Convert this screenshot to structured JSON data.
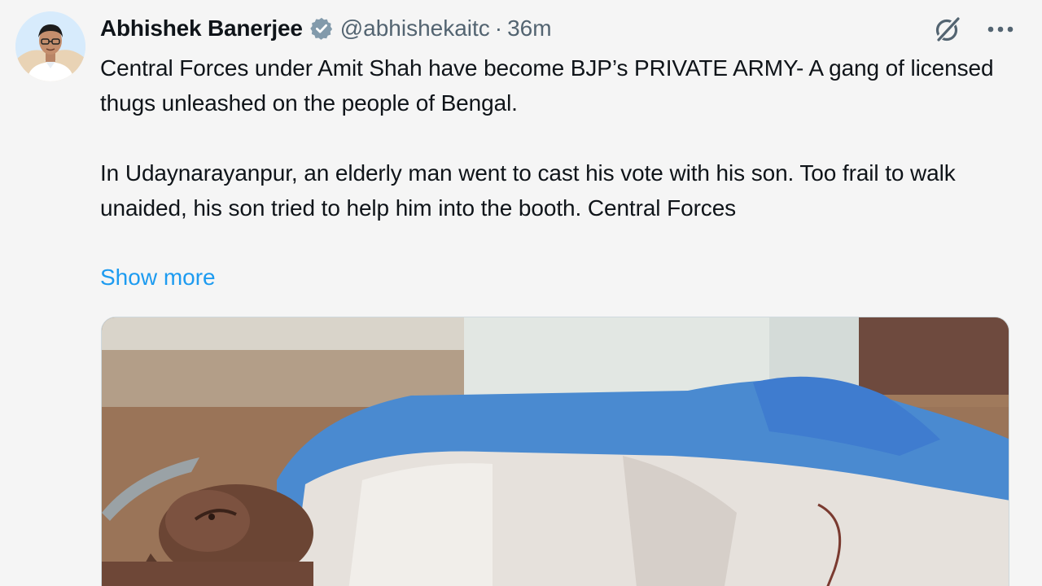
{
  "tweet": {
    "author_name": "Abhishek Banerjee",
    "handle": "@abhishekaitc",
    "separator": "·",
    "time": "36m",
    "paragraphs": [
      "Central Forces under Amit Shah have become BJP’s PRIVATE ARMY- A gang of licensed thugs unleashed on the people of Bengal.",
      "In Udaynarayanpur, an elderly man went to cast his vote with his son. Too frail to walk unaided, his son tried to help him into the booth. Central Forces"
    ],
    "show_more": "Show more"
  },
  "icons": {
    "verified": "verified-badge-icon",
    "grok": "grok-icon",
    "more": "more-options-icon"
  },
  "colors": {
    "link": "#1d9bf0",
    "secondary_text": "#536471",
    "verified_badge": "#829aab"
  }
}
